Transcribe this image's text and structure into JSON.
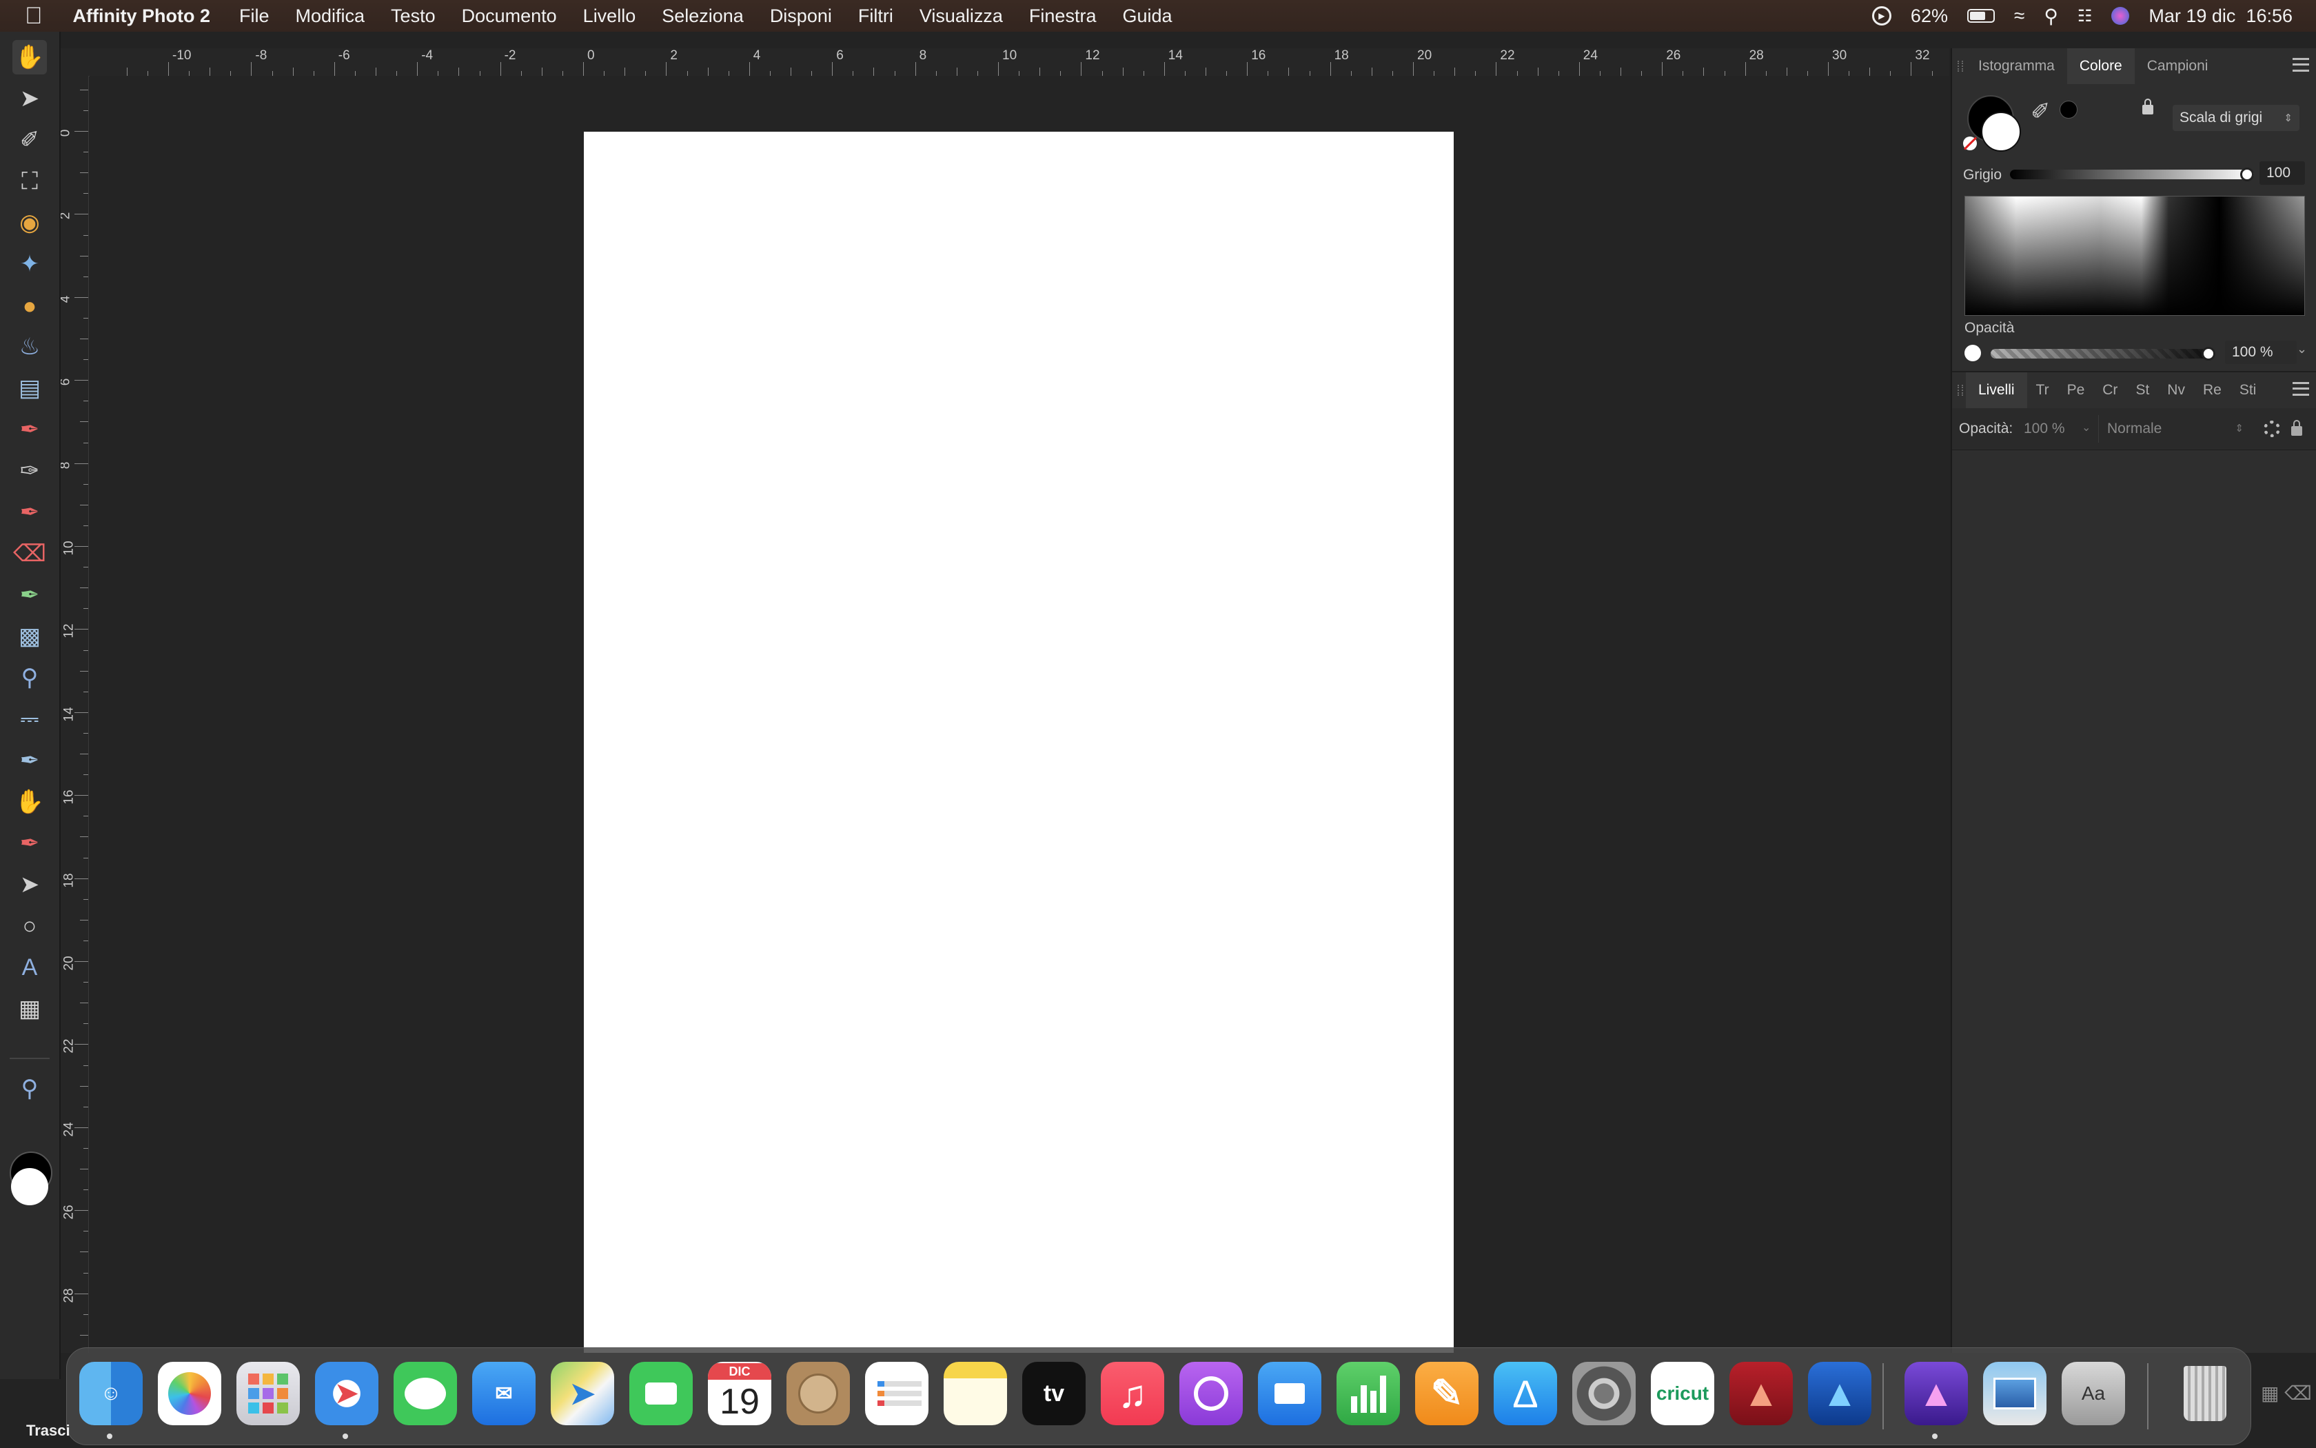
{
  "menubar": {
    "app_name": "Affinity Photo 2",
    "items": [
      "File",
      "Modifica",
      "Testo",
      "Documento",
      "Livello",
      "Seleziona",
      "Disponi",
      "Filtri",
      "Visualizza",
      "Finestra",
      "Guida"
    ],
    "battery": "62%",
    "datetime": "Mar 19 dic  16:56"
  },
  "ruler": {
    "unit": "cm",
    "top_labels": [
      "-10",
      "-8",
      "-6",
      "-4",
      "-2",
      "0",
      "2",
      "4",
      "6",
      "8",
      "10",
      "12",
      "14",
      "16",
      "18",
      "20",
      "22",
      "24",
      "26",
      "28",
      "30",
      "32"
    ],
    "left_labels": [
      "0",
      "2",
      "4",
      "6",
      "8",
      "10",
      "12",
      "14",
      "16",
      "18",
      "20",
      "22",
      "24",
      "26",
      "28"
    ]
  },
  "color_panel": {
    "tabs": [
      "Istogramma",
      "Colore",
      "Campioni"
    ],
    "active_tab": "Colore",
    "mode": "Scala di grigi",
    "grey_label": "Grigio",
    "grey_value": "100",
    "grey_fraction": 1.0,
    "opacity_label": "Opacità",
    "opacity_value": "100 %",
    "opacity_fraction": 1.0
  },
  "layers_panel": {
    "tabs": [
      "Livelli",
      "Tr",
      "Pe",
      "Cr",
      "St",
      "Nv",
      "Re",
      "Sti"
    ],
    "active_tab": "Livelli",
    "opacity_label": "Opacità:",
    "opacity_value": "100 %",
    "blend_mode": "Normale"
  },
  "dock": {
    "calendar_month": "DIC",
    "calendar_day": "19",
    "tv_label": "tv",
    "cricut_label": "cricut"
  },
  "status": {
    "text": "Trasci"
  },
  "colors": {
    "accent": "#f0a33a",
    "canvas_bg": "#242424",
    "document": "#ffffff"
  }
}
